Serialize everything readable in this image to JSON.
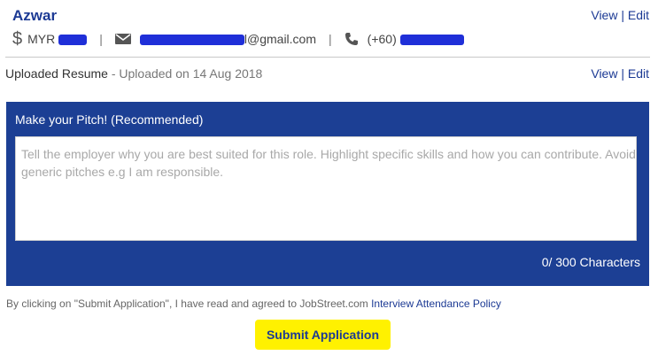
{
  "profile": {
    "name": "Azwar",
    "view_label": "View",
    "separator": "|",
    "edit_label": "Edit",
    "salary_currency": "MYR",
    "email_visible_suffix": "l@gmail.com",
    "phone_prefix": "(+60)"
  },
  "resume": {
    "label": "Uploaded Resume",
    "uploaded_text": " - Uploaded on 14 Aug 2018",
    "view_label": "View",
    "separator": "|",
    "edit_label": "Edit"
  },
  "pitch": {
    "title": "Make your Pitch! (Recommended)",
    "placeholder": "Tell the employer why you are best suited for this role. Highlight specific skills and how you can contribute. Avoid generic pitches e.g I am responsible.",
    "value": "",
    "counter": "0/ 300 Characters"
  },
  "footer": {
    "terms_text": "By clicking on \"Submit Application\", I have read and agreed to JobStreet.com ",
    "policy_link": "Interview Attendance Policy",
    "submit_label": "Submit Application"
  },
  "colors": {
    "brand_blue": "#1c3f94",
    "link_blue": "#1c3a94",
    "submit_yellow": "#fff100",
    "redaction_blue": "#1f2fd8"
  },
  "icons": [
    "dollar-icon",
    "envelope-icon",
    "phone-icon"
  ]
}
